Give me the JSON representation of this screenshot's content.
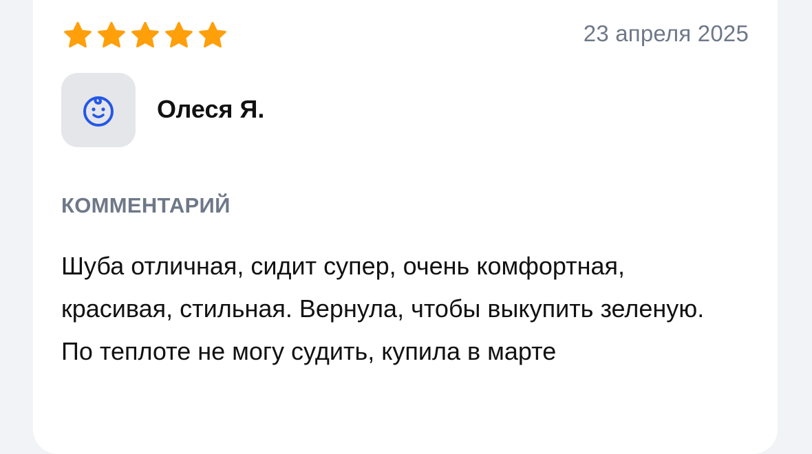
{
  "review": {
    "rating": 5,
    "rating_max": 5,
    "date": "23 апреля 2025",
    "author": {
      "name": "Олеся Я.",
      "avatar_icon": "baby-face-icon"
    },
    "comment_label": "КОММЕНТАРИЙ",
    "comment_text": "Шуба отличная, сидит супер, очень комфортная, красивая, стильная. Вернула, чтобы выкупить зеленую. По теплоте не могу судить, купила в марте"
  },
  "colors": {
    "star": "#ff9f0a",
    "avatar_icon": "#2458e6",
    "muted_text": "#6e7888",
    "avatar_bg": "#e4e6ea"
  }
}
